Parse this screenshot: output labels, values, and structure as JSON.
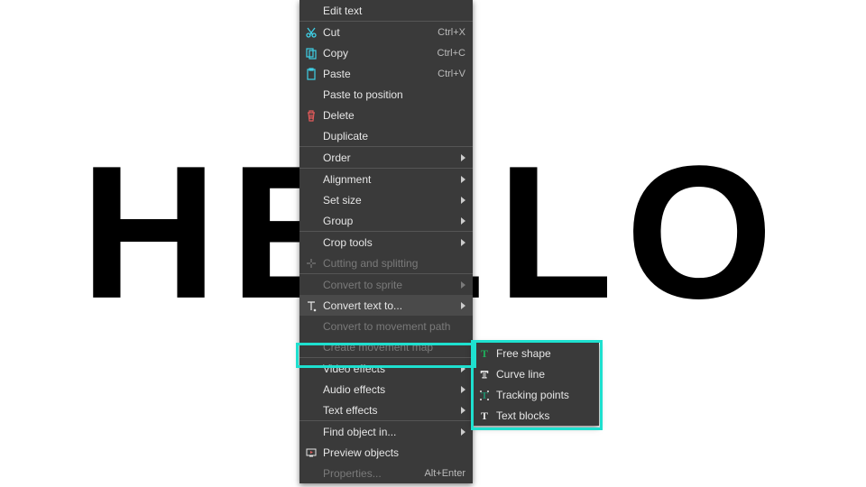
{
  "canvas": {
    "text": "HELLO"
  },
  "menu": {
    "edit_text": "Edit text",
    "cut": {
      "label": "Cut",
      "shortcut": "Ctrl+X"
    },
    "copy": {
      "label": "Copy",
      "shortcut": "Ctrl+C"
    },
    "paste": {
      "label": "Paste",
      "shortcut": "Ctrl+V"
    },
    "paste_pos": "Paste to position",
    "delete": "Delete",
    "duplicate": "Duplicate",
    "order": "Order",
    "alignment": "Alignment",
    "set_size": "Set size",
    "group": "Group",
    "crop_tools": "Crop tools",
    "cut_split": "Cutting and splitting",
    "conv_sprite": "Convert to sprite",
    "conv_text": "Convert text to...",
    "conv_path": "Convert to movement path",
    "create_map": "Create movement map",
    "video_fx": "Video effects",
    "audio_fx": "Audio effects",
    "text_fx": "Text effects",
    "find_obj": "Find object in...",
    "preview": "Preview objects",
    "properties": {
      "label": "Properties...",
      "shortcut": "Alt+Enter"
    }
  },
  "submenu": {
    "free_shape": "Free shape",
    "curve_line": "Curve line",
    "tracking": "Tracking points",
    "text_blocks": "Text blocks"
  }
}
